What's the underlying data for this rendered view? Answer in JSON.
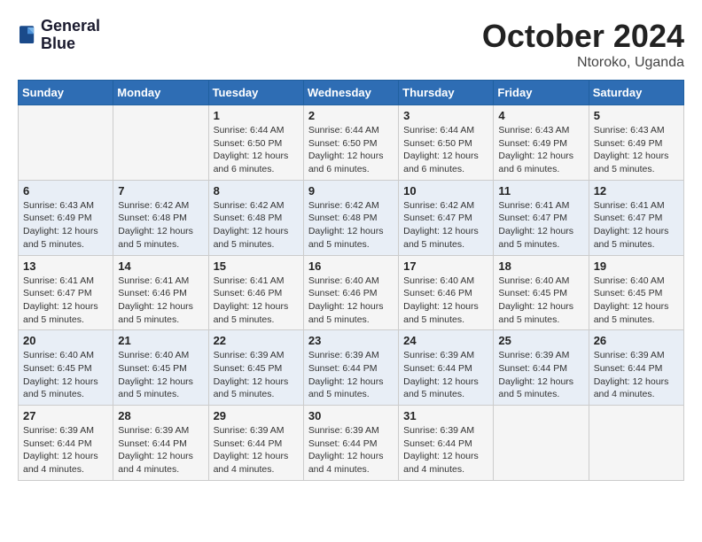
{
  "header": {
    "logo": {
      "line1": "General",
      "line2": "Blue"
    },
    "title": "October 2024",
    "location": "Ntoroko, Uganda"
  },
  "days_of_week": [
    "Sunday",
    "Monday",
    "Tuesday",
    "Wednesday",
    "Thursday",
    "Friday",
    "Saturday"
  ],
  "weeks": [
    [
      {
        "num": "",
        "info": ""
      },
      {
        "num": "",
        "info": ""
      },
      {
        "num": "1",
        "info": "Sunrise: 6:44 AM\nSunset: 6:50 PM\nDaylight: 12 hours\nand 6 minutes."
      },
      {
        "num": "2",
        "info": "Sunrise: 6:44 AM\nSunset: 6:50 PM\nDaylight: 12 hours\nand 6 minutes."
      },
      {
        "num": "3",
        "info": "Sunrise: 6:44 AM\nSunset: 6:50 PM\nDaylight: 12 hours\nand 6 minutes."
      },
      {
        "num": "4",
        "info": "Sunrise: 6:43 AM\nSunset: 6:49 PM\nDaylight: 12 hours\nand 6 minutes."
      },
      {
        "num": "5",
        "info": "Sunrise: 6:43 AM\nSunset: 6:49 PM\nDaylight: 12 hours\nand 5 minutes."
      }
    ],
    [
      {
        "num": "6",
        "info": "Sunrise: 6:43 AM\nSunset: 6:49 PM\nDaylight: 12 hours\nand 5 minutes."
      },
      {
        "num": "7",
        "info": "Sunrise: 6:42 AM\nSunset: 6:48 PM\nDaylight: 12 hours\nand 5 minutes."
      },
      {
        "num": "8",
        "info": "Sunrise: 6:42 AM\nSunset: 6:48 PM\nDaylight: 12 hours\nand 5 minutes."
      },
      {
        "num": "9",
        "info": "Sunrise: 6:42 AM\nSunset: 6:48 PM\nDaylight: 12 hours\nand 5 minutes."
      },
      {
        "num": "10",
        "info": "Sunrise: 6:42 AM\nSunset: 6:47 PM\nDaylight: 12 hours\nand 5 minutes."
      },
      {
        "num": "11",
        "info": "Sunrise: 6:41 AM\nSunset: 6:47 PM\nDaylight: 12 hours\nand 5 minutes."
      },
      {
        "num": "12",
        "info": "Sunrise: 6:41 AM\nSunset: 6:47 PM\nDaylight: 12 hours\nand 5 minutes."
      }
    ],
    [
      {
        "num": "13",
        "info": "Sunrise: 6:41 AM\nSunset: 6:47 PM\nDaylight: 12 hours\nand 5 minutes."
      },
      {
        "num": "14",
        "info": "Sunrise: 6:41 AM\nSunset: 6:46 PM\nDaylight: 12 hours\nand 5 minutes."
      },
      {
        "num": "15",
        "info": "Sunrise: 6:41 AM\nSunset: 6:46 PM\nDaylight: 12 hours\nand 5 minutes."
      },
      {
        "num": "16",
        "info": "Sunrise: 6:40 AM\nSunset: 6:46 PM\nDaylight: 12 hours\nand 5 minutes."
      },
      {
        "num": "17",
        "info": "Sunrise: 6:40 AM\nSunset: 6:46 PM\nDaylight: 12 hours\nand 5 minutes."
      },
      {
        "num": "18",
        "info": "Sunrise: 6:40 AM\nSunset: 6:45 PM\nDaylight: 12 hours\nand 5 minutes."
      },
      {
        "num": "19",
        "info": "Sunrise: 6:40 AM\nSunset: 6:45 PM\nDaylight: 12 hours\nand 5 minutes."
      }
    ],
    [
      {
        "num": "20",
        "info": "Sunrise: 6:40 AM\nSunset: 6:45 PM\nDaylight: 12 hours\nand 5 minutes."
      },
      {
        "num": "21",
        "info": "Sunrise: 6:40 AM\nSunset: 6:45 PM\nDaylight: 12 hours\nand 5 minutes."
      },
      {
        "num": "22",
        "info": "Sunrise: 6:39 AM\nSunset: 6:45 PM\nDaylight: 12 hours\nand 5 minutes."
      },
      {
        "num": "23",
        "info": "Sunrise: 6:39 AM\nSunset: 6:44 PM\nDaylight: 12 hours\nand 5 minutes."
      },
      {
        "num": "24",
        "info": "Sunrise: 6:39 AM\nSunset: 6:44 PM\nDaylight: 12 hours\nand 5 minutes."
      },
      {
        "num": "25",
        "info": "Sunrise: 6:39 AM\nSunset: 6:44 PM\nDaylight: 12 hours\nand 5 minutes."
      },
      {
        "num": "26",
        "info": "Sunrise: 6:39 AM\nSunset: 6:44 PM\nDaylight: 12 hours\nand 4 minutes."
      }
    ],
    [
      {
        "num": "27",
        "info": "Sunrise: 6:39 AM\nSunset: 6:44 PM\nDaylight: 12 hours\nand 4 minutes."
      },
      {
        "num": "28",
        "info": "Sunrise: 6:39 AM\nSunset: 6:44 PM\nDaylight: 12 hours\nand 4 minutes."
      },
      {
        "num": "29",
        "info": "Sunrise: 6:39 AM\nSunset: 6:44 PM\nDaylight: 12 hours\nand 4 minutes."
      },
      {
        "num": "30",
        "info": "Sunrise: 6:39 AM\nSunset: 6:44 PM\nDaylight: 12 hours\nand 4 minutes."
      },
      {
        "num": "31",
        "info": "Sunrise: 6:39 AM\nSunset: 6:44 PM\nDaylight: 12 hours\nand 4 minutes."
      },
      {
        "num": "",
        "info": ""
      },
      {
        "num": "",
        "info": ""
      }
    ]
  ]
}
